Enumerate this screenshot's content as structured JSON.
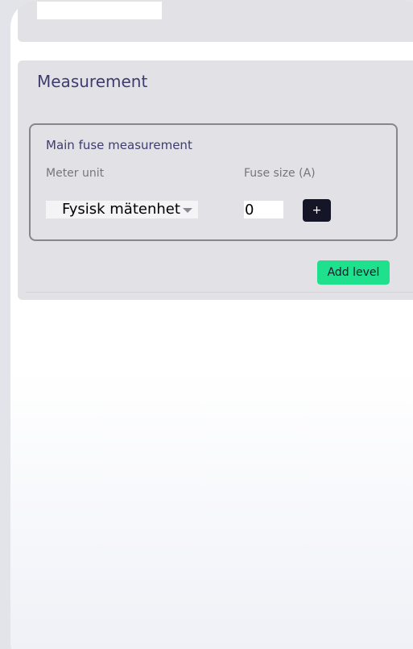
{
  "top_panel": {
    "field_value": ""
  },
  "measurement": {
    "title": "Measurement",
    "main_fuse": {
      "legend": "Main fuse measurement",
      "meter_unit_label": "Meter unit",
      "meter_unit_value": "Fysisk mätenhet",
      "fuse_size_label": "Fuse size (A)",
      "fuse_size_value": "0",
      "add_button_label": "+"
    },
    "add_level_label": "Add level"
  },
  "colors": {
    "panel_bg": "#e2e2e6",
    "title_text": "#3e3c6e",
    "plus_button_bg": "#151528",
    "add_level_bg": "#1ee08d"
  }
}
